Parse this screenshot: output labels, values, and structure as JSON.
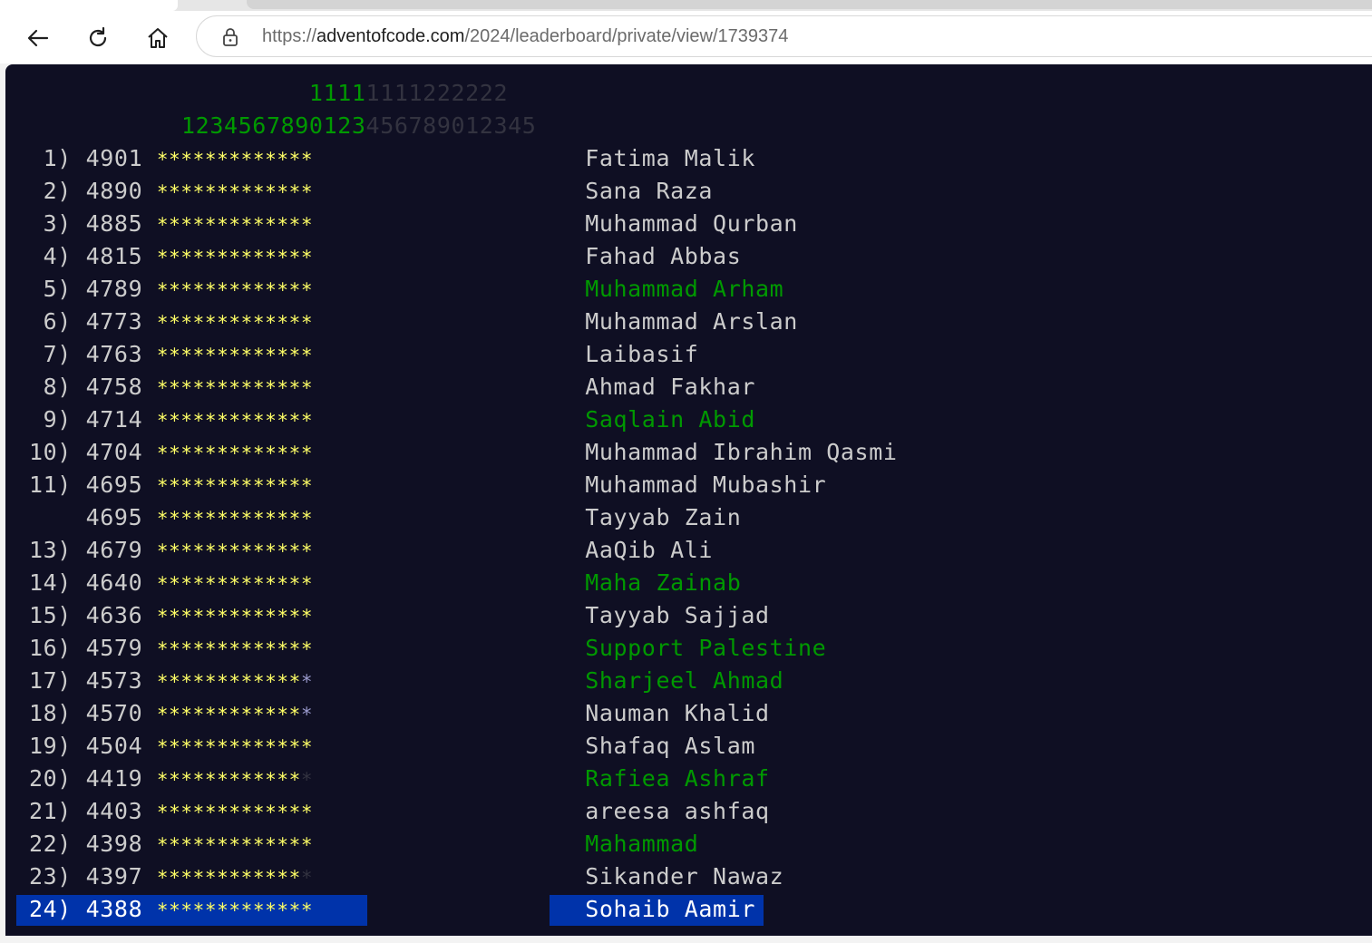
{
  "browser": {
    "url_scheme": "https://",
    "url_domain": "adventofcode.com",
    "url_path": "/2024/leaderboard/private/view/1739374"
  },
  "header": {
    "day_tens": "11111111222222",
    "day_ones": "1234567890123456789012345",
    "days_completed": 13
  },
  "colors": {
    "background": "#0f0f23",
    "gold_star": "#ffff66",
    "silver_star": "#9999cc",
    "green": "#009900",
    "highlight": "#0033aa"
  },
  "rows": [
    {
      "rank": "1)",
      "score": "4901",
      "stars": "ggggggggggggg",
      "name": "Fatima Malik",
      "link": false
    },
    {
      "rank": "2)",
      "score": "4890",
      "stars": "ggggggggggggg",
      "name": "Sana Raza",
      "link": false
    },
    {
      "rank": "3)",
      "score": "4885",
      "stars": "ggggggggggggg",
      "name": "Muhammad Qurban",
      "link": false
    },
    {
      "rank": "4)",
      "score": "4815",
      "stars": "ggggggggggggg",
      "name": "Fahad Abbas",
      "link": false
    },
    {
      "rank": "5)",
      "score": "4789",
      "stars": "ggggggggggggg",
      "name": "Muhammad Arham",
      "link": true
    },
    {
      "rank": "6)",
      "score": "4773",
      "stars": "ggggggggggggg",
      "name": "Muhammad Arslan",
      "link": false
    },
    {
      "rank": "7)",
      "score": "4763",
      "stars": "ggggggggggggg",
      "name": "Laibasif",
      "link": false
    },
    {
      "rank": "8)",
      "score": "4758",
      "stars": "ggggggggggggg",
      "name": "Ahmad Fakhar",
      "link": false
    },
    {
      "rank": "9)",
      "score": "4714",
      "stars": "ggggggggggggg",
      "name": "Saqlain Abid",
      "link": true
    },
    {
      "rank": "10)",
      "score": "4704",
      "stars": "ggggggggggggg",
      "name": "Muhammad Ibrahim Qasmi",
      "link": false
    },
    {
      "rank": "11)",
      "score": "4695",
      "stars": "ggggggggggggg",
      "name": "Muhammad Mubashir",
      "link": false
    },
    {
      "rank": "",
      "score": "4695",
      "stars": "ggggggggggggg",
      "name": "Tayyab Zain",
      "link": false
    },
    {
      "rank": "13)",
      "score": "4679",
      "stars": "ggggggggggggg",
      "name": "AaQib Ali",
      "link": false
    },
    {
      "rank": "14)",
      "score": "4640",
      "stars": "ggggggggggggg",
      "name": "Maha Zainab",
      "link": true
    },
    {
      "rank": "15)",
      "score": "4636",
      "stars": "ggggggggggggg",
      "name": "Tayyab Sajjad",
      "link": false
    },
    {
      "rank": "16)",
      "score": "4579",
      "stars": "ggggggggggggg",
      "name": "Support Palestine",
      "link": true
    },
    {
      "rank": "17)",
      "score": "4573",
      "stars": "ggggggggggggs",
      "name": "Sharjeel Ahmad",
      "link": true
    },
    {
      "rank": "18)",
      "score": "4570",
      "stars": "ggggggggggggs",
      "name": "Nauman Khalid",
      "link": false
    },
    {
      "rank": "19)",
      "score": "4504",
      "stars": "ggggggggggggg",
      "name": "Shafaq Aslam",
      "link": false
    },
    {
      "rank": "20)",
      "score": "4419",
      "stars": "ggggggggggggn",
      "name": "Rafiea Ashraf",
      "link": true
    },
    {
      "rank": "21)",
      "score": "4403",
      "stars": "ggggggggggggg",
      "name": "areesa ashfaq",
      "link": false
    },
    {
      "rank": "22)",
      "score": "4398",
      "stars": "ggggggggggggg",
      "name": "Mahammad",
      "link": true
    },
    {
      "rank": "23)",
      "score": "4397",
      "stars": "ggggggggggggn",
      "name": "Sikander Nawaz",
      "link": false
    },
    {
      "rank": "24)",
      "score": "4388",
      "stars": "ggggggggggggg",
      "name": "Sohaib Aamir",
      "link": false,
      "highlighted": true
    }
  ]
}
